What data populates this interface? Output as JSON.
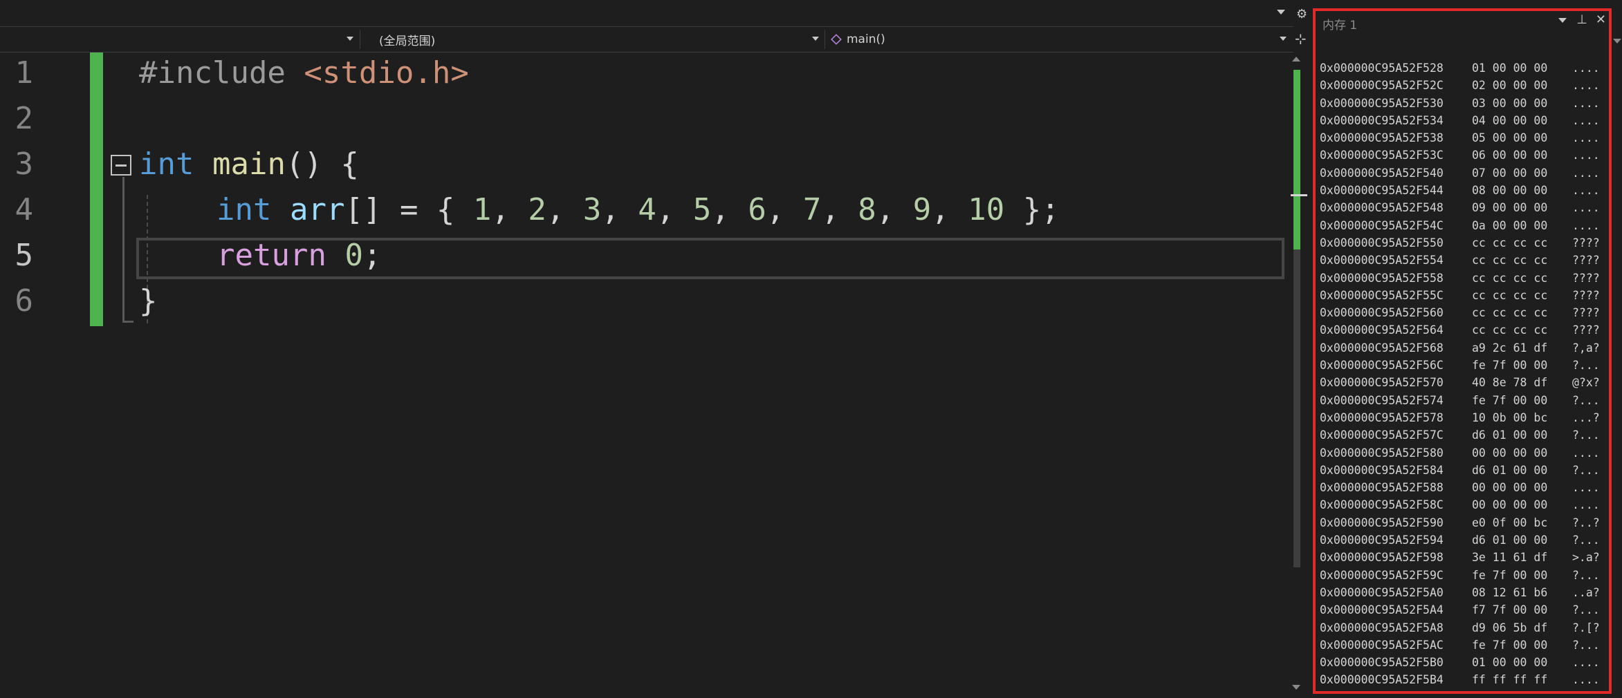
{
  "nav": {
    "scope_label": "(全局范围)",
    "function_label": "main()"
  },
  "editor": {
    "line_numbers": [
      "1",
      "2",
      "3",
      "4",
      "5",
      "6"
    ],
    "current_line": "5",
    "lines": {
      "l1": {
        "directive": "#include",
        "header": "<stdio.h>"
      },
      "l3": {
        "type": "int",
        "name": "main",
        "parens": "()",
        "brace": " {"
      },
      "l4": {
        "type": "int",
        "var": "arr",
        "rest_a": "[] = { ",
        "nums": [
          "1",
          "2",
          "3",
          "4",
          "5",
          "6",
          "7",
          "8",
          "9",
          "10"
        ],
        "rest_b": " };"
      },
      "l5": {
        "keyword": "return",
        "value": "0",
        "semi": ";"
      },
      "l6": {
        "brace": "}"
      }
    }
  },
  "memory": {
    "title": "内存 1",
    "rows": [
      {
        "addr": "0x000000C95A52F528",
        "bytes": "01 00 00 00",
        "chars": "...."
      },
      {
        "addr": "0x000000C95A52F52C",
        "bytes": "02 00 00 00",
        "chars": "...."
      },
      {
        "addr": "0x000000C95A52F530",
        "bytes": "03 00 00 00",
        "chars": "...."
      },
      {
        "addr": "0x000000C95A52F534",
        "bytes": "04 00 00 00",
        "chars": "...."
      },
      {
        "addr": "0x000000C95A52F538",
        "bytes": "05 00 00 00",
        "chars": "...."
      },
      {
        "addr": "0x000000C95A52F53C",
        "bytes": "06 00 00 00",
        "chars": "...."
      },
      {
        "addr": "0x000000C95A52F540",
        "bytes": "07 00 00 00",
        "chars": "...."
      },
      {
        "addr": "0x000000C95A52F544",
        "bytes": "08 00 00 00",
        "chars": "...."
      },
      {
        "addr": "0x000000C95A52F548",
        "bytes": "09 00 00 00",
        "chars": "...."
      },
      {
        "addr": "0x000000C95A52F54C",
        "bytes": "0a 00 00 00",
        "chars": "...."
      },
      {
        "addr": "0x000000C95A52F550",
        "bytes": "cc cc cc cc",
        "chars": "????"
      },
      {
        "addr": "0x000000C95A52F554",
        "bytes": "cc cc cc cc",
        "chars": "????"
      },
      {
        "addr": "0x000000C95A52F558",
        "bytes": "cc cc cc cc",
        "chars": "????"
      },
      {
        "addr": "0x000000C95A52F55C",
        "bytes": "cc cc cc cc",
        "chars": "????"
      },
      {
        "addr": "0x000000C95A52F560",
        "bytes": "cc cc cc cc",
        "chars": "????"
      },
      {
        "addr": "0x000000C95A52F564",
        "bytes": "cc cc cc cc",
        "chars": "????"
      },
      {
        "addr": "0x000000C95A52F568",
        "bytes": "a9 2c 61 df",
        "chars": "?,a?"
      },
      {
        "addr": "0x000000C95A52F56C",
        "bytes": "fe 7f 00 00",
        "chars": "?..."
      },
      {
        "addr": "0x000000C95A52F570",
        "bytes": "40 8e 78 df",
        "chars": "@?x?"
      },
      {
        "addr": "0x000000C95A52F574",
        "bytes": "fe 7f 00 00",
        "chars": "?..."
      },
      {
        "addr": "0x000000C95A52F578",
        "bytes": "10 0b 00 bc",
        "chars": "...?"
      },
      {
        "addr": "0x000000C95A52F57C",
        "bytes": "d6 01 00 00",
        "chars": "?..."
      },
      {
        "addr": "0x000000C95A52F580",
        "bytes": "00 00 00 00",
        "chars": "...."
      },
      {
        "addr": "0x000000C95A52F584",
        "bytes": "d6 01 00 00",
        "chars": "?..."
      },
      {
        "addr": "0x000000C95A52F588",
        "bytes": "00 00 00 00",
        "chars": "...."
      },
      {
        "addr": "0x000000C95A52F58C",
        "bytes": "00 00 00 00",
        "chars": "...."
      },
      {
        "addr": "0x000000C95A52F590",
        "bytes": "e0 0f 00 bc",
        "chars": "?..?"
      },
      {
        "addr": "0x000000C95A52F594",
        "bytes": "d6 01 00 00",
        "chars": "?..."
      },
      {
        "addr": "0x000000C95A52F598",
        "bytes": "3e 11 61 df",
        "chars": ">.a?"
      },
      {
        "addr": "0x000000C95A52F59C",
        "bytes": "fe 7f 00 00",
        "chars": "?..."
      },
      {
        "addr": "0x000000C95A52F5A0",
        "bytes": "08 12 61 b6",
        "chars": "..a?"
      },
      {
        "addr": "0x000000C95A52F5A4",
        "bytes": "f7 7f 00 00",
        "chars": "?..."
      },
      {
        "addr": "0x000000C95A52F5A8",
        "bytes": "d9 06 5b df",
        "chars": "?.[?"
      },
      {
        "addr": "0x000000C95A52F5AC",
        "bytes": "fe 7f 00 00",
        "chars": "?..."
      },
      {
        "addr": "0x000000C95A52F5B0",
        "bytes": "01 00 00 00",
        "chars": "...."
      },
      {
        "addr": "0x000000C95A52F5B4",
        "bytes": "ff ff ff ff",
        "chars": "...."
      }
    ]
  }
}
